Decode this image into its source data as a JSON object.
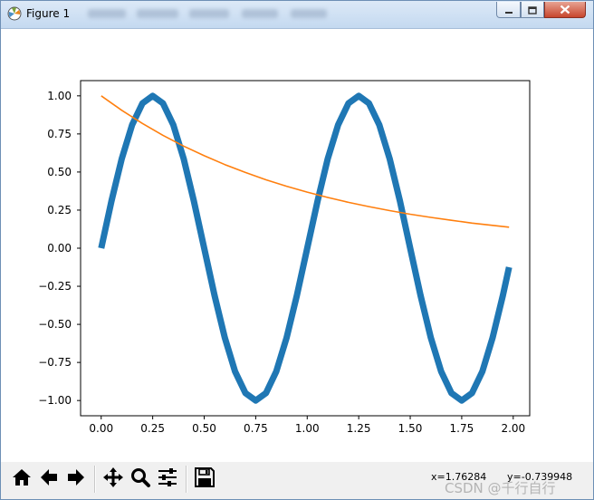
{
  "window": {
    "title": "Figure 1",
    "icon": "matplotlib-icon",
    "controls": [
      "minimize-icon",
      "maximize-icon",
      "close-icon"
    ]
  },
  "chart_data": {
    "type": "line",
    "title": "",
    "xlabel": "",
    "ylabel": "",
    "xlim": [
      -0.1,
      2.08
    ],
    "ylim": [
      -1.1,
      1.1
    ],
    "xticks": [
      0.0,
      0.25,
      0.5,
      0.75,
      1.0,
      1.25,
      1.5,
      1.75,
      2.0
    ],
    "xtick_labels": [
      "0.00",
      "0.25",
      "0.50",
      "0.75",
      "1.00",
      "1.25",
      "1.50",
      "1.75",
      "2.00"
    ],
    "yticks": [
      1.0,
      0.75,
      0.5,
      0.25,
      0.0,
      -0.25,
      -0.5,
      -0.75,
      -1.0
    ],
    "ytick_labels": [
      "1.00",
      "0.75",
      "0.50",
      "0.25",
      "0.00",
      "−0.25",
      "−0.50",
      "−0.75",
      "−1.00"
    ],
    "grid": false,
    "legend": "none",
    "series": [
      {
        "color": "#1f77b4",
        "linewidth": "thick",
        "x": [
          0.0,
          0.05,
          0.1,
          0.15,
          0.2,
          0.25,
          0.3,
          0.35,
          0.4,
          0.45,
          0.5,
          0.55,
          0.6,
          0.65,
          0.7,
          0.75,
          0.8,
          0.85,
          0.9,
          0.95,
          1.0,
          1.05,
          1.1,
          1.15,
          1.2,
          1.25,
          1.3,
          1.35,
          1.4,
          1.45,
          1.5,
          1.55,
          1.6,
          1.65,
          1.7,
          1.75,
          1.8,
          1.85,
          1.9,
          1.95,
          1.98
        ],
        "y": [
          0.0,
          0.309,
          0.588,
          0.809,
          0.951,
          1.0,
          0.951,
          0.809,
          0.588,
          0.309,
          0.0,
          -0.309,
          -0.588,
          -0.809,
          -0.951,
          -1.0,
          -0.951,
          -0.809,
          -0.588,
          -0.309,
          0.0,
          0.309,
          0.588,
          0.809,
          0.951,
          1.0,
          0.951,
          0.809,
          0.588,
          0.309,
          0.0,
          -0.309,
          -0.588,
          -0.809,
          -0.951,
          -1.0,
          -0.951,
          -0.809,
          -0.588,
          -0.309,
          -0.125
        ]
      },
      {
        "color": "#ff7f0e",
        "linewidth": "thin",
        "x": [
          0.0,
          0.1,
          0.2,
          0.3,
          0.4,
          0.5,
          0.6,
          0.7,
          0.8,
          0.9,
          1.0,
          1.1,
          1.2,
          1.3,
          1.4,
          1.5,
          1.6,
          1.7,
          1.8,
          1.9,
          1.98
        ],
        "y": [
          1.0,
          0.905,
          0.819,
          0.741,
          0.67,
          0.607,
          0.549,
          0.497,
          0.449,
          0.407,
          0.368,
          0.333,
          0.301,
          0.273,
          0.247,
          0.223,
          0.202,
          0.183,
          0.165,
          0.15,
          0.138
        ]
      }
    ]
  },
  "toolbar": {
    "buttons": [
      "home-icon",
      "back-icon",
      "forward-icon",
      "pan-icon",
      "zoom-icon",
      "configure-subplots-icon",
      "save-icon"
    ],
    "coord_x": "x=1.76284",
    "coord_y": "y=-0.739948"
  },
  "watermark": "CSDN @千行自行"
}
